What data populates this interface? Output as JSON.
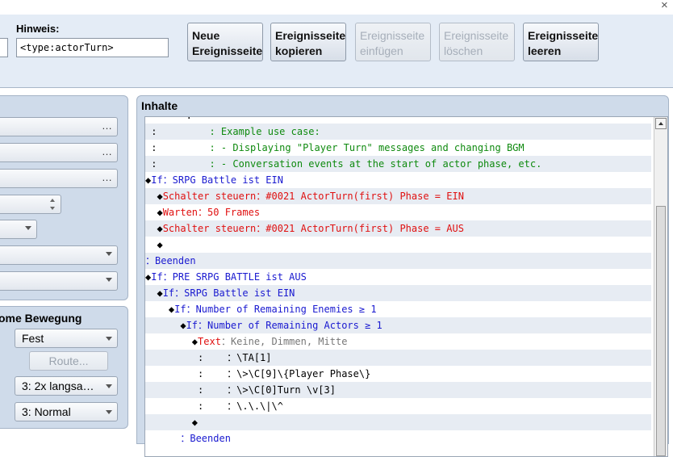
{
  "window": {
    "close_glyph": "×"
  },
  "toolbar": {
    "hint_label": "Hinweis:",
    "hint_value": "<type:actorTurn>",
    "buttons": [
      {
        "label1": "Neue",
        "label2": "Ereignisseite",
        "enabled": true
      },
      {
        "label1": "Ereignisseite",
        "label2": "kopieren",
        "enabled": true
      },
      {
        "label1": "Ereignisseite",
        "label2": "einfügen",
        "enabled": false
      },
      {
        "label1": "Ereignisseite",
        "label2": "löschen",
        "enabled": false
      },
      {
        "label1": "Ereignisseite",
        "label2": "leeren",
        "enabled": true
      }
    ]
  },
  "left_panel": {
    "fields": [
      "…",
      "…",
      "…"
    ],
    "ellipsis": "…"
  },
  "movement": {
    "title": "ome Bewegung",
    "type_value": "Fest",
    "route_label": "Route...",
    "speed_value": "3: 2x langsa…",
    "frequency_value": "3: Normal"
  },
  "content": {
    "title": "Inhalte",
    "rows": [
      {
        "parts": [
          {
            "t": "       :",
            "c": "c-black"
          }
        ]
      },
      {
        "parts": [
          {
            "t": " :         ",
            "c": "c-black"
          },
          {
            "t": ": Example use case:",
            "c": "c-green"
          }
        ]
      },
      {
        "parts": [
          {
            "t": " :         ",
            "c": "c-black"
          },
          {
            "t": ": - Displaying \"Player Turn\" messages and changing BGM",
            "c": "c-green"
          }
        ]
      },
      {
        "parts": [
          {
            "t": " :         ",
            "c": "c-black"
          },
          {
            "t": ": - Conversation events at the start of actor phase, etc.",
            "c": "c-green"
          }
        ]
      },
      {
        "parts": [
          {
            "t": "◆",
            "c": "c-black"
          },
          {
            "t": "If：SRPG Battle ist EIN",
            "c": "c-blue"
          }
        ]
      },
      {
        "parts": [
          {
            "t": "  ◆",
            "c": "c-black"
          },
          {
            "t": "Schalter steuern：#0021 ActorTurn(first) Phase = EIN",
            "c": "c-red"
          }
        ]
      },
      {
        "parts": [
          {
            "t": "  ◆",
            "c": "c-black"
          },
          {
            "t": "Warten：50 Frames",
            "c": "c-red"
          }
        ]
      },
      {
        "parts": [
          {
            "t": "  ◆",
            "c": "c-black"
          },
          {
            "t": "Schalter steuern：#0021 ActorTurn(first) Phase = AUS",
            "c": "c-red"
          }
        ]
      },
      {
        "parts": [
          {
            "t": "  ◆",
            "c": "c-black"
          }
        ]
      },
      {
        "parts": [
          {
            "t": "：Beenden",
            "c": "c-blue"
          }
        ]
      },
      {
        "parts": [
          {
            "t": "◆",
            "c": "c-black"
          },
          {
            "t": "If：PRE SRPG BATTLE ist AUS",
            "c": "c-blue"
          }
        ]
      },
      {
        "parts": [
          {
            "t": "  ◆",
            "c": "c-black"
          },
          {
            "t": "If：SRPG Battle ist EIN",
            "c": "c-blue"
          }
        ]
      },
      {
        "parts": [
          {
            "t": "    ◆",
            "c": "c-black"
          },
          {
            "t": "If：Number of Remaining Enemies ≥ 1",
            "c": "c-blue"
          }
        ]
      },
      {
        "parts": [
          {
            "t": "      ◆",
            "c": "c-black"
          },
          {
            "t": "If：Number of Remaining Actors ≥ 1",
            "c": "c-blue"
          }
        ]
      },
      {
        "parts": [
          {
            "t": "        ◆",
            "c": "c-black"
          },
          {
            "t": "Text",
            "c": "c-red"
          },
          {
            "t": "：Keine, Dimmen, Mitte",
            "c": "c-gray"
          }
        ]
      },
      {
        "parts": [
          {
            "t": "         :    ",
            "c": "c-black"
          },
          {
            "t": "：\\TA[1]",
            "c": "c-black"
          }
        ]
      },
      {
        "parts": [
          {
            "t": "         :    ",
            "c": "c-black"
          },
          {
            "t": "：\\>\\C[9]\\{Player Phase\\}",
            "c": "c-black"
          }
        ]
      },
      {
        "parts": [
          {
            "t": "         :    ",
            "c": "c-black"
          },
          {
            "t": "：\\>\\C[0]Turn \\v[3]",
            "c": "c-black"
          }
        ]
      },
      {
        "parts": [
          {
            "t": "         :    ",
            "c": "c-black"
          },
          {
            "t": "：\\.\\.\\|\\^",
            "c": "c-black"
          }
        ]
      },
      {
        "parts": [
          {
            "t": "        ◆",
            "c": "c-black"
          }
        ]
      },
      {
        "parts": [
          {
            "t": "      ：Beenden",
            "c": "c-blue"
          }
        ]
      }
    ]
  }
}
